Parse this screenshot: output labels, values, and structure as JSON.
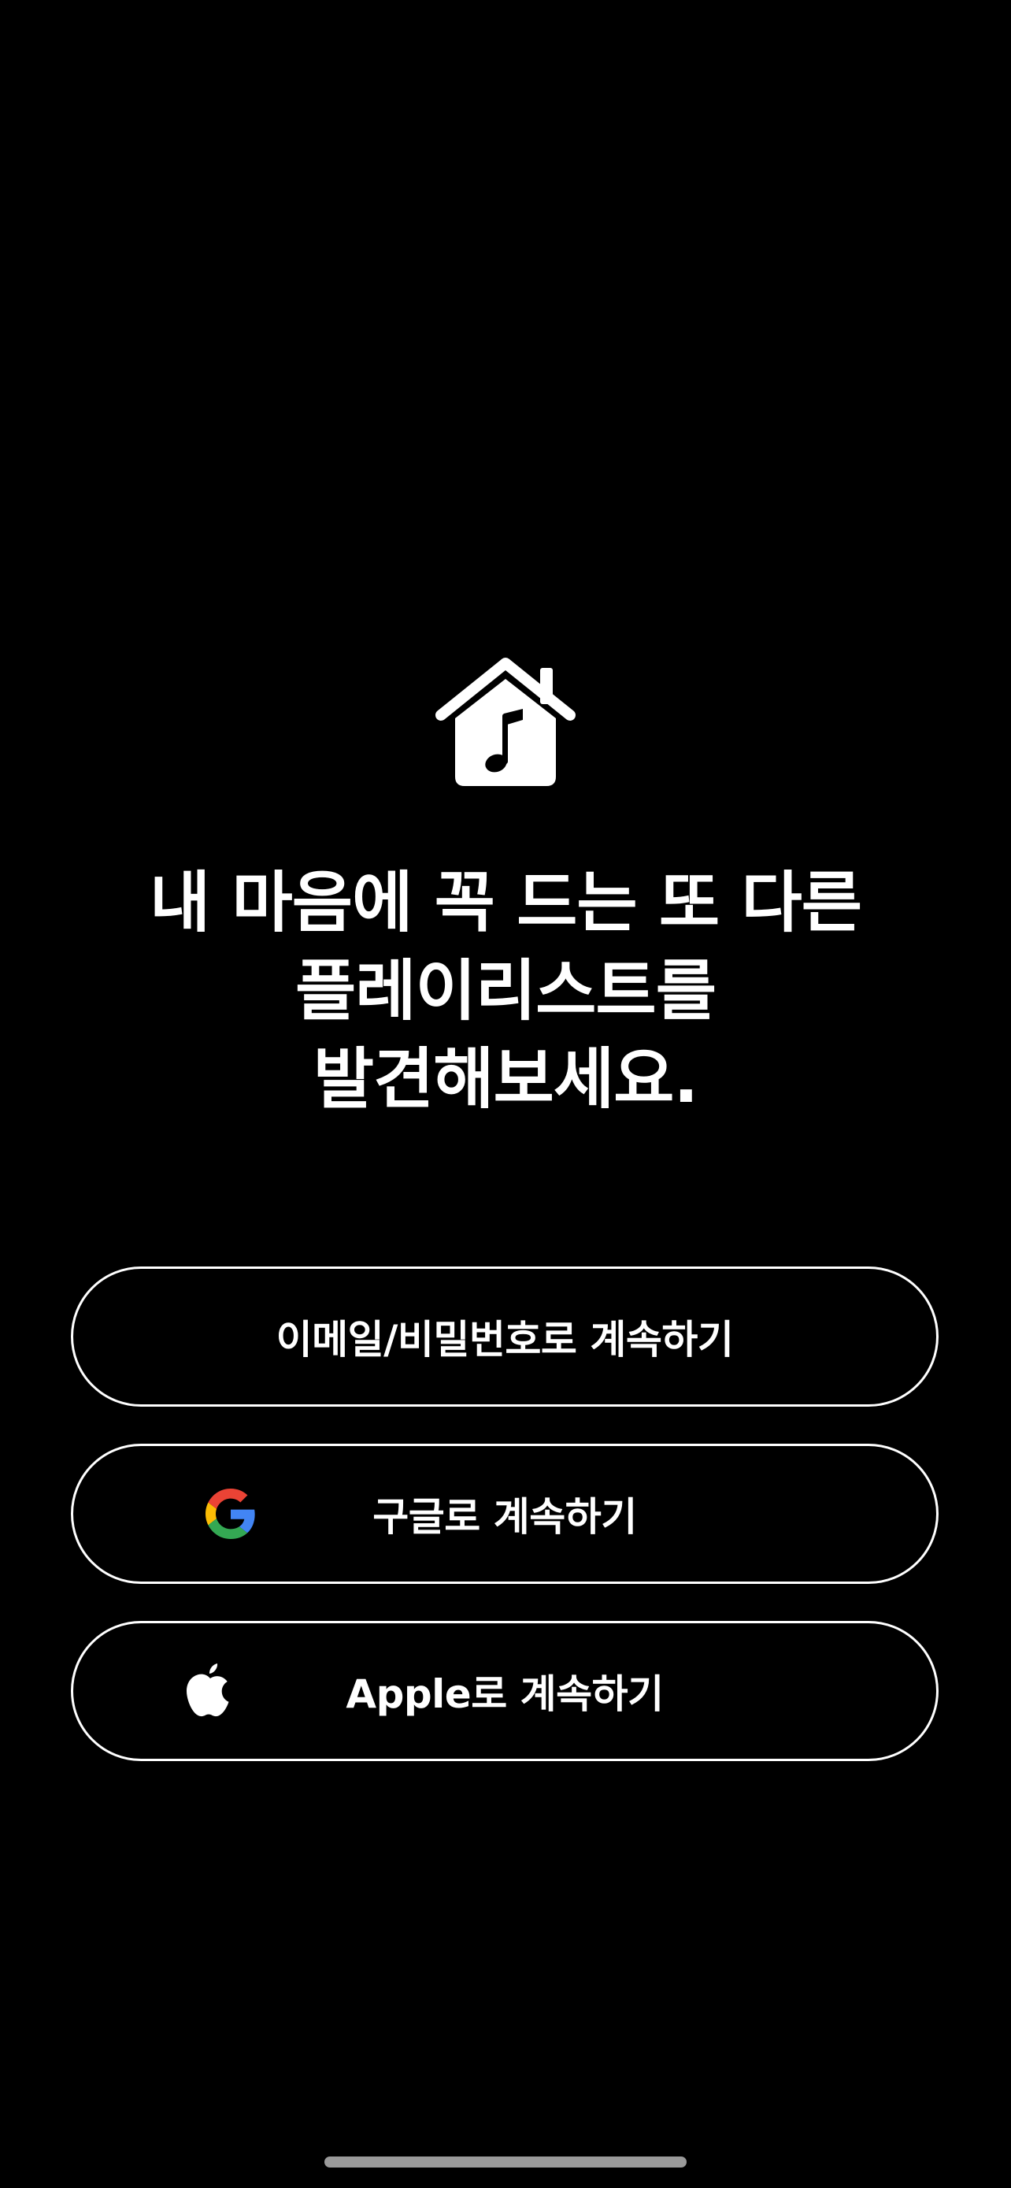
{
  "app": {
    "logo_icon": "house-music-note-icon"
  },
  "headline": {
    "line1": "내 마음에 꼭 드는 또 다른",
    "line2": "플레이리스트를",
    "line3": "발견해보세요."
  },
  "buttons": {
    "email": {
      "label": "이메일/비밀번호로 계속하기"
    },
    "google": {
      "label": "구글로 계속하기",
      "icon": "google-icon"
    },
    "apple": {
      "label": "Apple로 계속하기",
      "icon": "apple-icon"
    }
  },
  "colors": {
    "background": "#000000",
    "foreground": "#ffffff",
    "google_blue": "#4285F4",
    "google_red": "#EA4335",
    "google_yellow": "#FBBC05",
    "google_green": "#34A853"
  }
}
